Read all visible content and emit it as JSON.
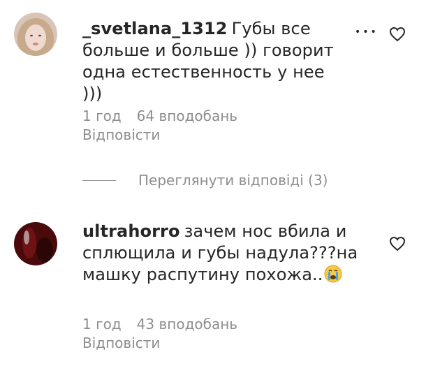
{
  "comments": [
    {
      "username": "_svetlana_1312",
      "text": "Губы все больше и больше )) говорит одна естественность у нее )))",
      "time": "1 год",
      "likes": "64 вподобань",
      "reply_label": "Відповісти",
      "avatar_icon": "avatar-blonde-woman",
      "like_icon": "heart-outline-icon",
      "more_icon": "more-dots-icon"
    },
    {
      "username": "ultrahorro",
      "text": "зачем нос вбила и сплющила и губы надула???на машку распутину похожа..",
      "emoji": "crying-face-emoji",
      "time": "1 год",
      "likes": "43 вподобань",
      "reply_label": "Відповісти",
      "avatar_icon": "avatar-dark-red",
      "like_icon": "heart-outline-icon"
    }
  ],
  "view_replies": {
    "label": "Переглянути відповіді (3)"
  },
  "colors": {
    "text": "#262626",
    "secondary": "#8e8e8e",
    "background": "#ffffff"
  }
}
